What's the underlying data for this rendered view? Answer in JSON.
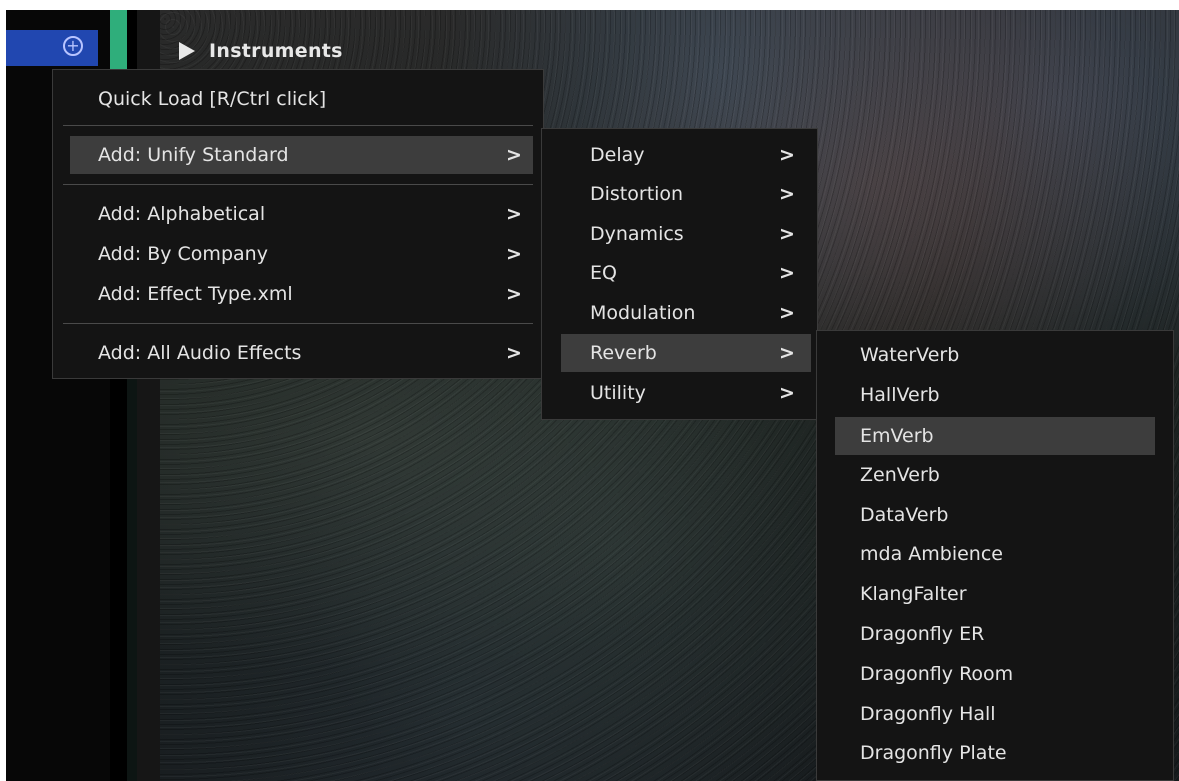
{
  "track_header": {
    "add_icon": "plus-circle-icon",
    "expand_icon": "triangle-right-icon",
    "instruments_label": "Instruments"
  },
  "menu_main": {
    "quick_load": "Quick Load [R/Ctrl click]",
    "items": [
      {
        "label": "Add: Unify Standard",
        "arrow": ">"
      },
      {
        "label": "Add: Alphabetical",
        "arrow": ">"
      },
      {
        "label": "Add: By Company",
        "arrow": ">"
      },
      {
        "label": "Add: Effect Type.xml",
        "arrow": ">"
      },
      {
        "label": "Add: All Audio Effects",
        "arrow": ">"
      }
    ]
  },
  "menu_categories": {
    "items": [
      {
        "label": "Delay",
        "arrow": ">"
      },
      {
        "label": "Distortion",
        "arrow": ">"
      },
      {
        "label": "Dynamics",
        "arrow": ">"
      },
      {
        "label": "EQ",
        "arrow": ">"
      },
      {
        "label": "Modulation",
        "arrow": ">"
      },
      {
        "label": "Reverb",
        "arrow": ">"
      },
      {
        "label": "Utility",
        "arrow": ">"
      }
    ]
  },
  "menu_reverb": {
    "items": [
      "WaterVerb",
      "HallVerb",
      "EmVerb",
      "ZenVerb",
      "DataVerb",
      "mda Ambience",
      "KlangFalter",
      "Dragonfly ER",
      "Dragonfly Room",
      "Dragonfly Hall",
      "Dragonfly Plate"
    ]
  },
  "colors": {
    "add_tab": "#2147b0",
    "track_green": "#2fae7b",
    "menu_bg": "#141414",
    "highlight": "#3d3d3d"
  }
}
